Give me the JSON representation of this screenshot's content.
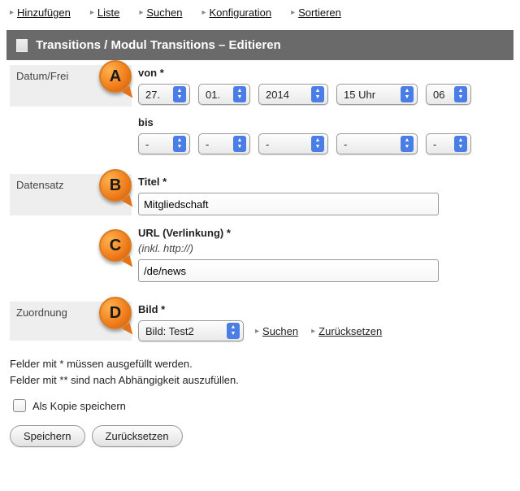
{
  "nav": [
    "Hinzufügen",
    "Liste",
    "Suchen",
    "Konfiguration",
    "Sortieren"
  ],
  "header_title": "Transitions / Modul Transitions – Editieren",
  "annot": {
    "a": "A",
    "b": "B",
    "c": "C",
    "d": "D"
  },
  "group_labels": {
    "datum": "Datum/Frei",
    "datensatz": "Datensatz",
    "zuordnung": "Zuordnung"
  },
  "von": {
    "label": "von *",
    "day": "27.",
    "month": "01.",
    "year": "2014",
    "hour": "15 Uhr",
    "minute": "06"
  },
  "bis": {
    "label": "bis",
    "day": "-",
    "month": "-",
    "year": "-",
    "hour": "-",
    "minute": "-"
  },
  "titel": {
    "label": "Titel *",
    "value": "Mitgliedschaft"
  },
  "url": {
    "label": "URL (Verlinkung) *",
    "hint": "(inkl. http://)",
    "value": "/de/news"
  },
  "bild": {
    "label": "Bild *",
    "value": "Bild: Test2",
    "search": "Suchen",
    "reset": "Zurücksetzen"
  },
  "notes": {
    "line1": "Felder mit * müssen ausgefüllt werden.",
    "line2": "Felder mit ** sind nach Abhängigkeit auszufüllen."
  },
  "save_copy_label": "Als Kopie speichern",
  "buttons": {
    "save": "Speichern",
    "reset": "Zurücksetzen"
  }
}
